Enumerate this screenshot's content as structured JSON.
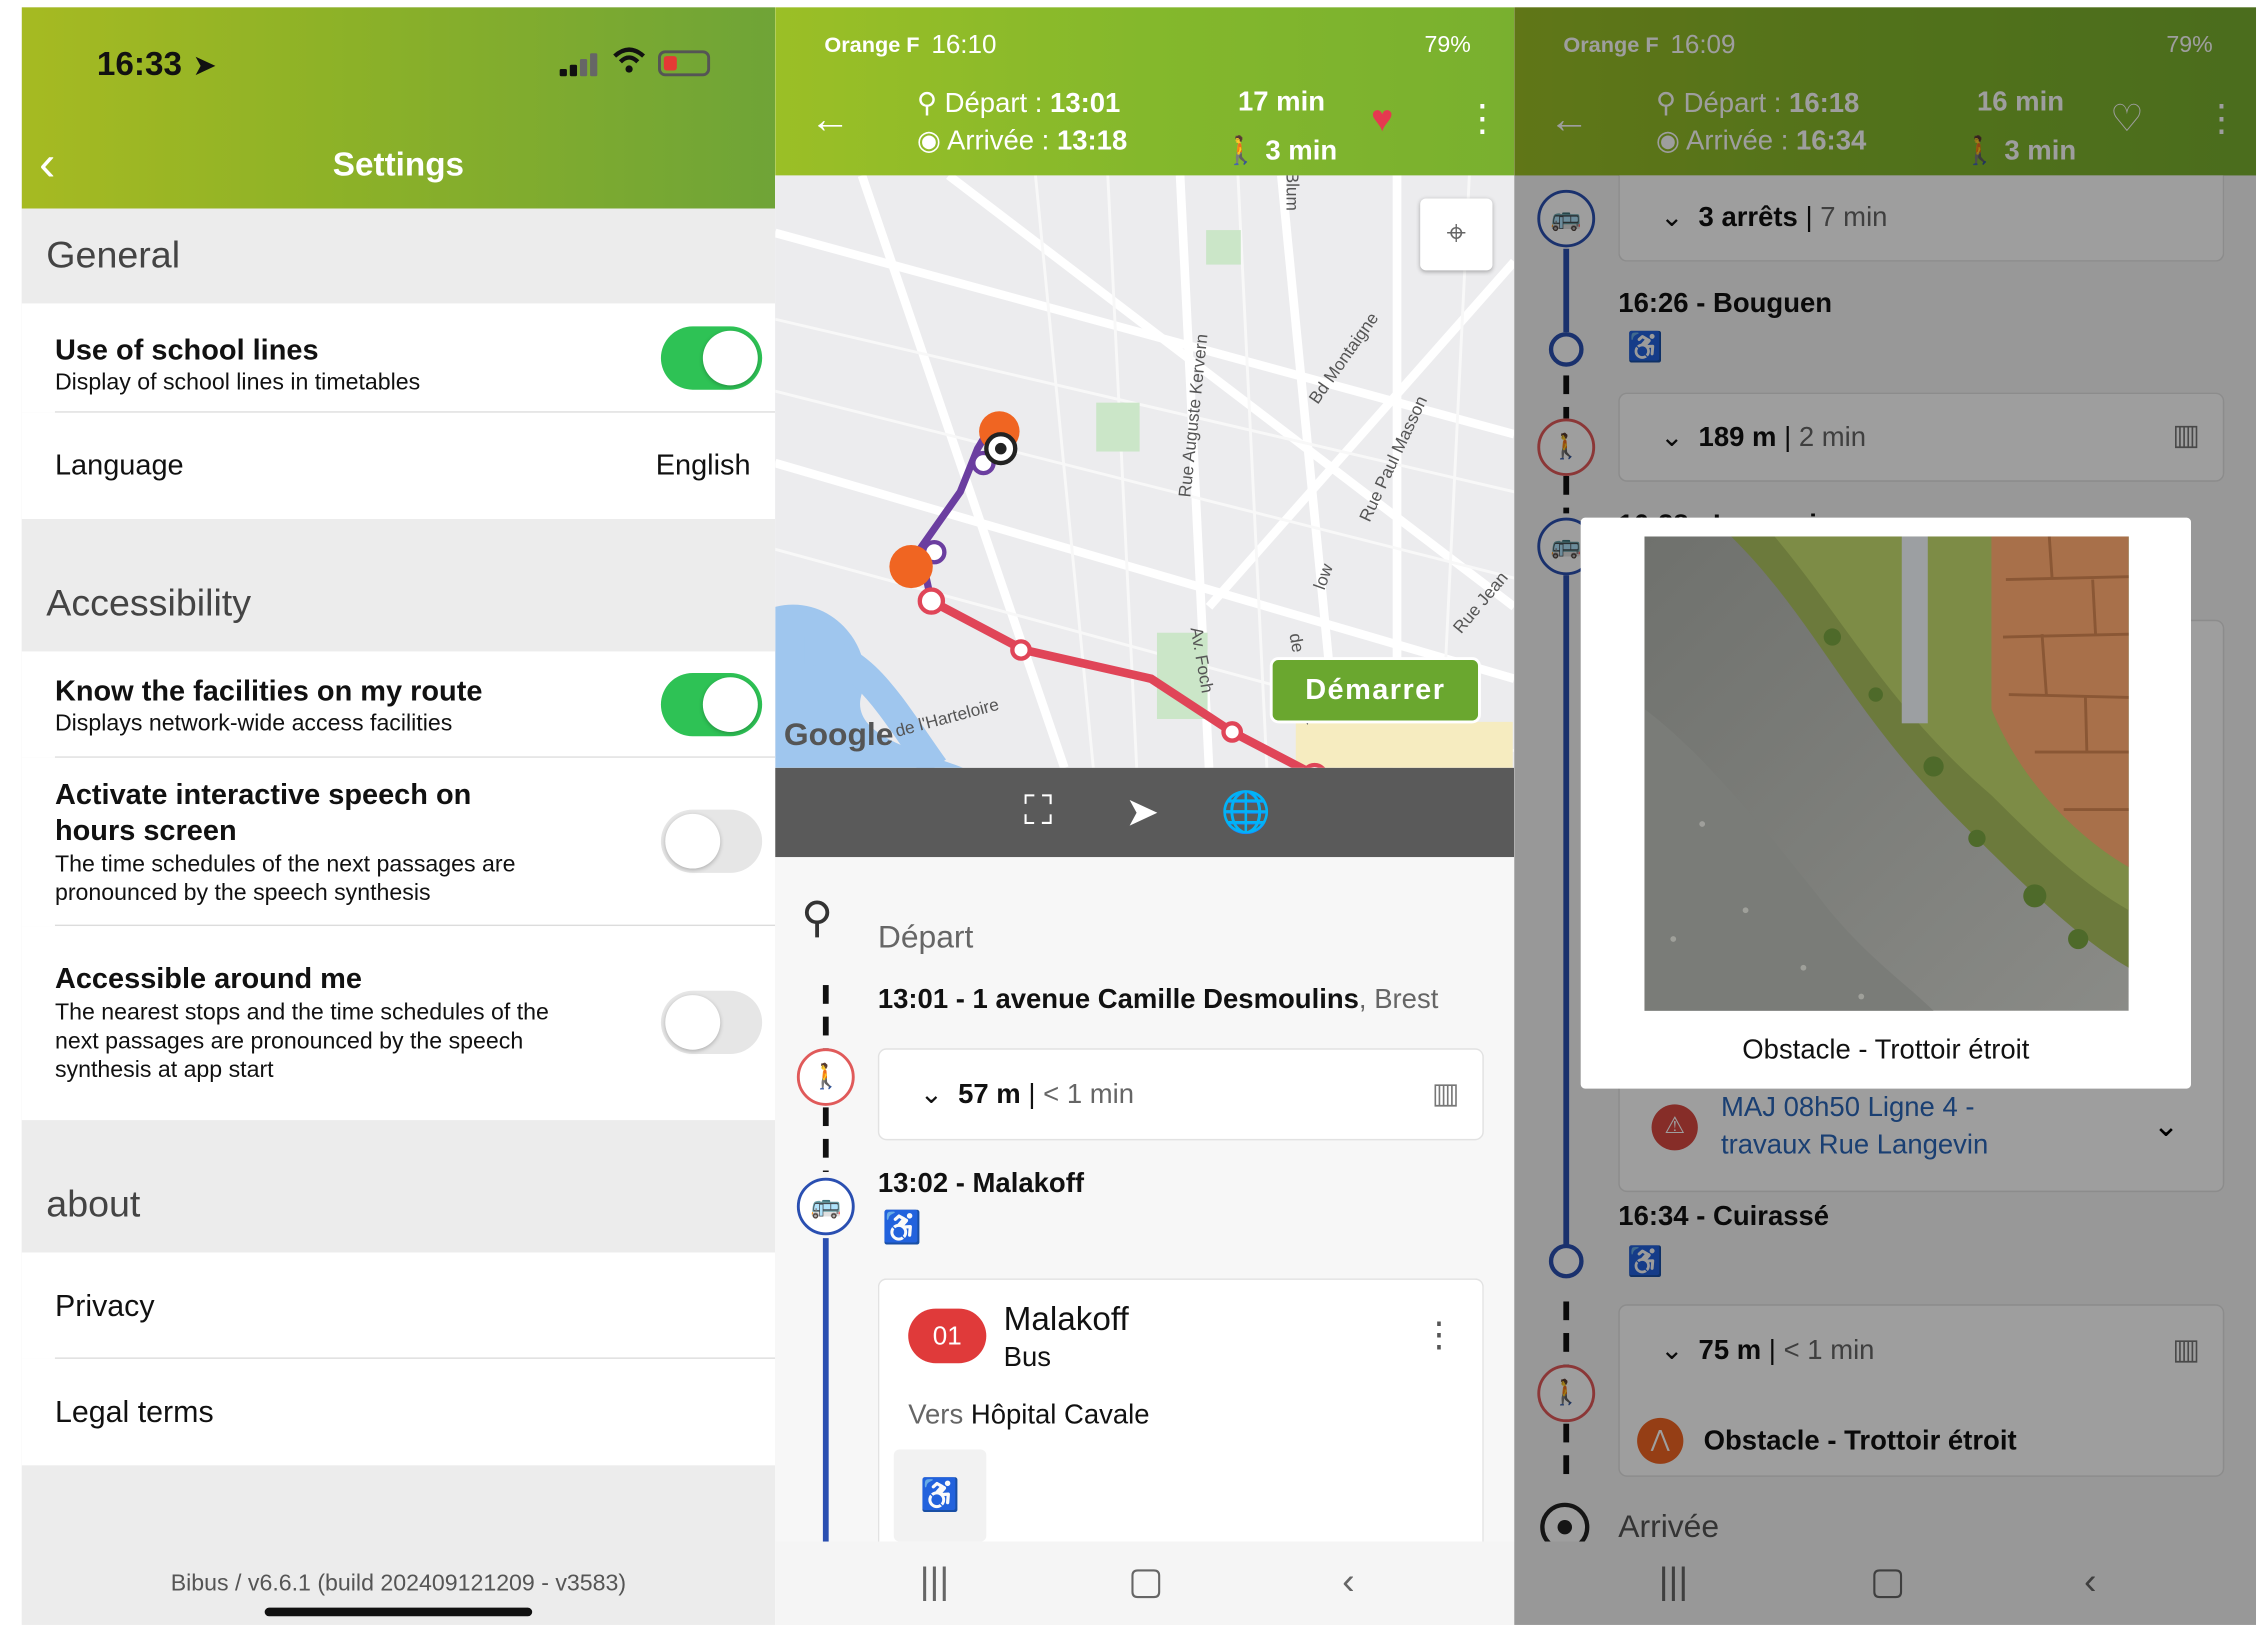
{
  "panel1": {
    "status": {
      "time": "16:33"
    },
    "header": {
      "title": "Settings"
    },
    "general": {
      "title": "General",
      "school": {
        "title": "Use of school lines",
        "subtitle": "Display of school lines in timetables",
        "enabled": true
      },
      "language": {
        "label": "Language",
        "value": "English"
      }
    },
    "accessibility": {
      "title": "Accessibility",
      "facilities": {
        "title": "Know the facilities on my route",
        "subtitle": "Displays network-wide access facilities",
        "enabled": true
      },
      "speech_l1": "Activate interactive speech on",
      "speech_l2": "hours screen",
      "speech_sub1": "The time schedules of the next passages are",
      "speech_sub2": "pronounced by the speech synthesis",
      "speech_enabled": false,
      "around_title": "Accessible around me",
      "around_sub1": "The nearest stops and the time schedules of the",
      "around_sub2": "next passages are pronounced by the speech",
      "around_sub3": "synthesis at app start",
      "around_enabled": false
    },
    "about": {
      "title": "about",
      "privacy": "Privacy",
      "legal": "Legal terms"
    },
    "footer": "Bibus / v6.6.1 (build 202409121209 - v3583)"
  },
  "panel2": {
    "status": {
      "carrier": "Orange F",
      "time": "16:10",
      "battery": "79%"
    },
    "header": {
      "departure_label": "Départ :",
      "departure_time": "13:01",
      "arrival_label": "Arrivée :",
      "arrival_time": "13:18",
      "duration": "17 min",
      "walk": "3 min"
    },
    "map": {
      "start_button": "Démarrer",
      "google": "Google",
      "streets": [
        "Blum",
        "Bd Montaigne",
        "Rue Auguste Kervern",
        "Rue Paul Masson",
        "Av. Foch",
        "Rue Jean",
        "de l'Harteloire",
        "de",
        "low"
      ]
    },
    "itinerary": {
      "departure_title": "Départ",
      "start_time": "13:01 - ",
      "start_place": "1 avenue Camille Desmoulins",
      "start_city": ", Brest",
      "walk_distance": "57 m",
      "walk_time": "< 1 min",
      "stop_time": "13:02 - Malakoff",
      "line_number": "01",
      "line_name": "Malakoff",
      "line_mode": "Bus",
      "direction_prefix": "Vers",
      "direction": "Hôpital Cavale"
    }
  },
  "panel3": {
    "status": {
      "carrier": "Orange F",
      "time": "16:09",
      "battery": "79%"
    },
    "header": {
      "departure_label": "Départ :",
      "departure_time": "16:18",
      "arrival_label": "Arrivée :",
      "arrival_time": "16:34",
      "duration": "16 min",
      "walk": "3 min"
    },
    "steps": {
      "stops_count": "3 arrêts",
      "stops_time": "7 min",
      "bouguen": "16:26 - Bouguen",
      "walk1_distance": "189 m",
      "walk1_time": "2 min",
      "partial": "16:28 - Langevin",
      "alert_l1": "MAJ 08h50 Ligne 4 -",
      "alert_l2": "travaux Rue Langevin",
      "cuirasse": "16:34 - Cuirassé",
      "walk2_distance": "75 m",
      "walk2_time": "< 1 min",
      "obstacle": "Obstacle - Trottoir étroit",
      "arrival": "Arrivée"
    },
    "modal": {
      "caption": "Obstacle - Trottoir étroit"
    }
  }
}
